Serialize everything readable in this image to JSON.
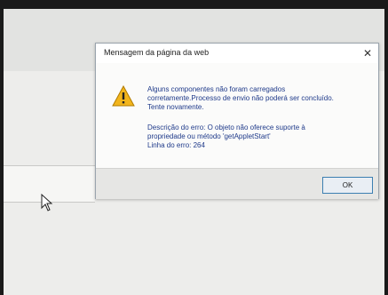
{
  "dialog": {
    "title": "Mensagem da página da web",
    "message_lines": [
      "Alguns componentes não foram carregados",
      "corretamente.Processo de envio não poderá ser concluído.",
      "Tente novamente."
    ],
    "detail_lines": [
      "Descrição do erro: O objeto não oferece suporte à",
      "propriedade ou método 'getAppletStart'",
      "Linha do erro: 264"
    ],
    "ok_label": "OK",
    "close_symbol": "✕"
  },
  "icons": {
    "warning": "warning-icon",
    "close": "close-icon",
    "cursor": "mouse-pointer-icon"
  },
  "colors": {
    "message_text": "#1f3a8a",
    "warning_fill": "#f2b51c",
    "ok_border": "#3c7fb1"
  }
}
